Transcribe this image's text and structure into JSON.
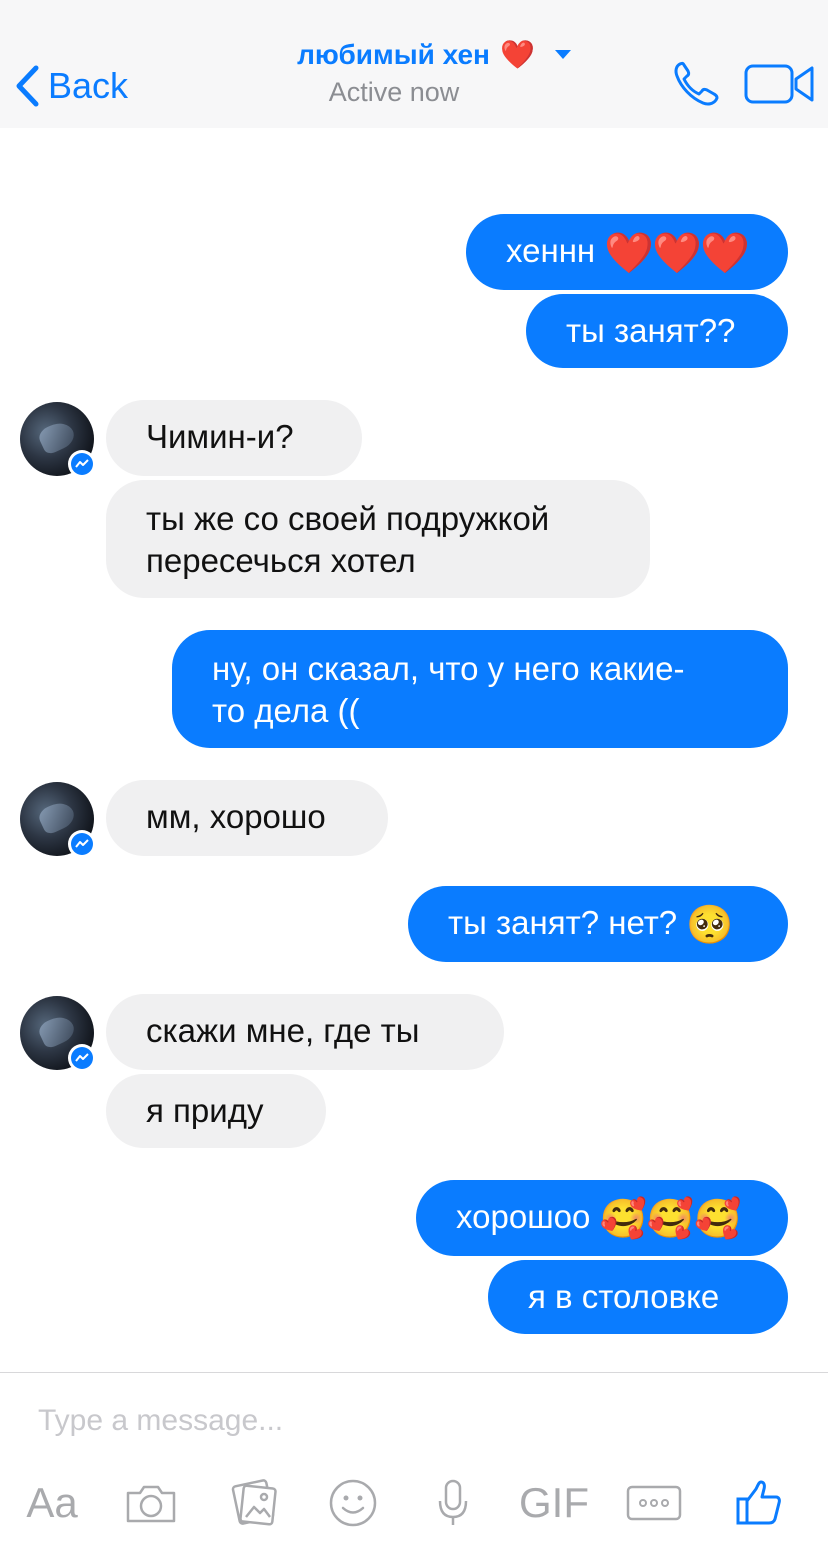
{
  "header": {
    "back_label": "Back",
    "contact_name": "любимый хен",
    "name_emoji": "❤️",
    "status": "Active now"
  },
  "messages": [
    {
      "dir": "out",
      "text": "хеннн",
      "emoji": "❤️❤️❤️"
    },
    {
      "dir": "out",
      "text": "ты занят??"
    },
    {
      "dir": "in",
      "text": "Чимин-и?"
    },
    {
      "dir": "in",
      "line1": "ты же со своей подружкой",
      "line2": "пересечься хотел"
    },
    {
      "dir": "out",
      "line1": "ну, он сказал, что у него какие-",
      "line2": "то дела (("
    },
    {
      "dir": "in",
      "text": "мм, хорошо"
    },
    {
      "dir": "out",
      "text": "ты занят? нет?",
      "emoji": "🥺"
    },
    {
      "dir": "in",
      "text": "скажи мне, где ты"
    },
    {
      "dir": "in",
      "text": "я приду"
    },
    {
      "dir": "out",
      "text": "хорошоо",
      "emoji": "🥰🥰🥰"
    },
    {
      "dir": "out",
      "text": "я в столовке"
    }
  ],
  "composer": {
    "placeholder": "Type a message...",
    "aa_label": "Aa",
    "gif_label": "GIF"
  },
  "colors": {
    "accent": "#0a7cff",
    "incoming_bubble": "#f0f0f1",
    "header_bg": "#f7f7f8",
    "icon_gray": "#a9aaad"
  }
}
